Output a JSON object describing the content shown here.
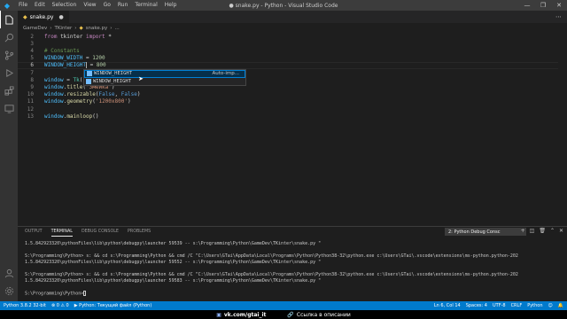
{
  "titlebar": {
    "menu": [
      "File",
      "Edit",
      "Selection",
      "View",
      "Go",
      "Run",
      "Terminal",
      "Help"
    ],
    "title": "● snake.py - Python - Visual Studio Code",
    "controls": {
      "minimize": "—",
      "maximize": "❐",
      "close": "✕"
    }
  },
  "activity_bar": {
    "items": [
      "explorer-icon",
      "search-icon",
      "source-control-icon",
      "run-debug-icon",
      "extensions-icon",
      "remote-icon"
    ],
    "bottom": [
      "account-icon",
      "settings-gear-icon"
    ]
  },
  "tab": {
    "label": "snake.py",
    "close": "●"
  },
  "breadcrumb": [
    "GameDev",
    "TKinter",
    "snake.py",
    "..."
  ],
  "editor": {
    "lines": [
      {
        "n": "2",
        "code": "from tkinter import *"
      },
      {
        "n": "3",
        "code": ""
      },
      {
        "n": "4",
        "code": "# Constants"
      },
      {
        "n": "5",
        "code": "WINDOW_WIDTH = 1200"
      },
      {
        "n": "6",
        "code": "WINDOW_HEIGHT = 800"
      },
      {
        "n": "7",
        "code": ""
      },
      {
        "n": "8",
        "code": "window = Tk()"
      },
      {
        "n": "9",
        "code": "window.title('Змейка')"
      },
      {
        "n": "10",
        "code": "window.resizable(False, False)"
      },
      {
        "n": "11",
        "code": "window.geometry('1200x800')"
      },
      {
        "n": "12",
        "code": ""
      },
      {
        "n": "13",
        "code": "window.mainloop()"
      }
    ],
    "line2": {
      "kw1": "from",
      "mod": " tkinter ",
      "kw2": "import",
      "rest": " *"
    },
    "line4": {
      "comment": "# Constants"
    },
    "line5": {
      "name": "WINDOW_WIDTH",
      "op": " = ",
      "val": "1200"
    },
    "line6": {
      "name": "WINDOW_HEIGHT",
      "op": " = ",
      "val": "800"
    },
    "line8": {
      "name": "window",
      "op": " = ",
      "cls": "Tk",
      "rest": "()"
    },
    "line9": {
      "obj": "window",
      "dot": ".",
      "fn": "title",
      "open": "(",
      "str": "'Змейка'",
      "close": ")"
    },
    "line10": {
      "obj": "window",
      "dot": ".",
      "fn": "resizable",
      "open": "(",
      "a1": "False",
      "sep": ", ",
      "a2": "False",
      "close": ")"
    },
    "line11": {
      "obj": "window",
      "dot": ".",
      "fn": "geometry",
      "open": "(",
      "str": "'1200x800'",
      "close": ")"
    },
    "line13": {
      "obj": "window",
      "dot": ".",
      "fn": "mainloop",
      "rest": "()"
    }
  },
  "suggest": {
    "items": [
      {
        "label": "WINDOW_HEIGHT",
        "detail": "Auto-imp..."
      },
      {
        "label": "WINDOW_HEIGHT",
        "detail": ""
      }
    ]
  },
  "panel": {
    "tabs": [
      "OUTPUT",
      "TERMINAL",
      "DEBUG CONSOLE",
      "PROBLEMS"
    ],
    "active_tab": "TERMINAL",
    "terminal_select": "2: Python Debug Consc",
    "actions": [
      "add-terminal-icon",
      "split-terminal-icon",
      "trash-icon",
      "chevron-up-icon",
      "close-icon"
    ],
    "terminal_lines": [
      "1.5.842923320\\pythonFiles\\lib\\python\\debugpy\\launcher 59539 -- s:\\Programming\\Python\\GameDev\\TKinter\\snake.py \"",
      "",
      "S:\\Programming\\Python> s: && cd s:\\Programming\\Python && cmd /C \"C:\\Users\\GTai\\AppData\\Local\\Programs\\Python\\Python38-32\\python.exe c:\\Users\\GTai\\.vscode\\extensions\\ms-python.python-202",
      "1.5.842923320\\pythonFiles\\lib\\python\\debugpy\\launcher 59552 -- s:\\Programming\\Python\\GameDev\\TKinter\\snake.py \"",
      "",
      "S:\\Programming\\Python> s: && cd s:\\Programming\\Python && cmd /C \"C:\\Users\\GTai\\AppData\\Local\\Programs\\Python\\Python38-32\\python.exe c:\\Users\\GTai\\.vscode\\extensions\\ms-python.python-202",
      "1.5.842923320\\pythonFiles\\lib\\python\\debugpy\\launcher 59583 -- s:\\Programming\\Python\\GameDev\\TKinter\\snake.py \"",
      "",
      "S:\\Programming\\Python>"
    ]
  },
  "statusbar": {
    "left": [
      "Python 3.8.2 32-bit",
      "⊗ 0 ⚠ 0",
      "▶ Python: Текущий файл (Python)"
    ],
    "right": [
      "Ln 6, Col 14",
      "Spaces: 4",
      "UTF-8",
      "CRLF",
      "Python"
    ]
  },
  "overlay": {
    "left": "vk.com/gtai_it",
    "right": "Ссылка в описании"
  },
  "colors": {
    "accent": "#007acc",
    "editor_bg": "#1e1e1e",
    "keyword": "#c586c0",
    "variable": "#4fc1ff",
    "number": "#b5cea8",
    "string": "#ce9178",
    "comment": "#6a9955"
  }
}
